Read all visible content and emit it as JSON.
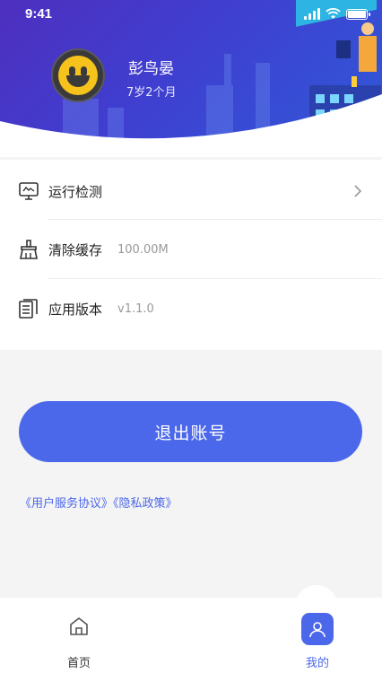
{
  "status_bar": {
    "time": "9:41"
  },
  "profile": {
    "name": "彭鸟晏",
    "age": "7岁2个月"
  },
  "menu": {
    "items": [
      {
        "label": "运行检测",
        "value": ""
      },
      {
        "label": "清除缓存",
        "value": "100.00M"
      },
      {
        "label": "应用版本",
        "value": "v1.1.0"
      }
    ]
  },
  "logout_label": "退出账号",
  "links": {
    "service": "《用户服务协议》",
    "privacy": "《隐私政策》"
  },
  "tabbar": {
    "home": "首页",
    "mine": "我的"
  },
  "colors": {
    "accent": "#4c68ea",
    "header_start": "#4e2fbf",
    "header_end": "#2f5ad8"
  },
  "icons": {
    "avatar": "smiley-face-icon",
    "menu": [
      "monitor-icon",
      "broom-icon",
      "documents-icon"
    ],
    "chevron": "chevron-right-icon",
    "home": "home-icon",
    "mine": "user-icon"
  }
}
